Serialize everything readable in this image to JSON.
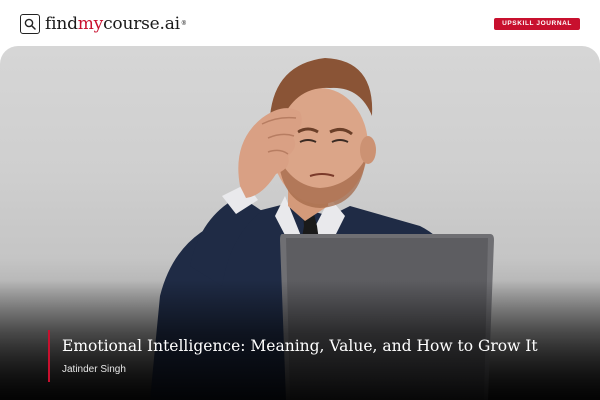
{
  "brand": {
    "name_part1": "find",
    "name_accent": "my",
    "name_part2": "course.ai",
    "superscript": "®",
    "accent_color": "#c8102e"
  },
  "header": {
    "badge_label": "UPSKILL JOURNAL"
  },
  "hero": {
    "image_subject": "stressed-businessman-at-laptop",
    "title": "Emotional Intelligence: Meaning, Value, and How to Grow It",
    "author": "Jatinder Singh"
  },
  "icons": {
    "logo": "search-icon"
  }
}
